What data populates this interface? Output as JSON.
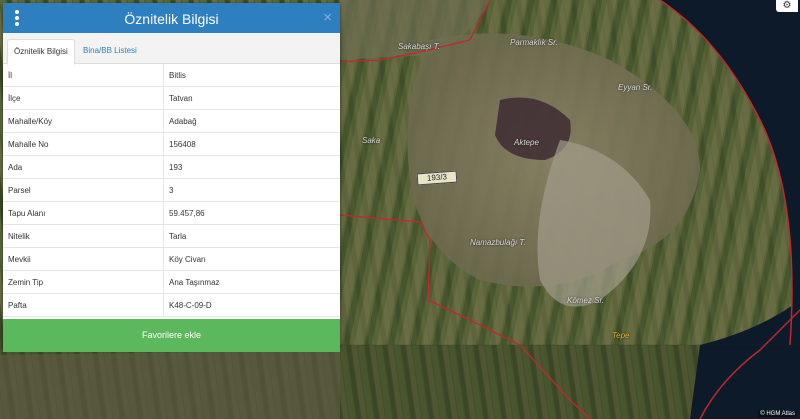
{
  "panel": {
    "title": "Öznitelik Bilgisi",
    "close_glyph": "×",
    "menu_icon": "vertical-dots-icon",
    "tabs": [
      {
        "label": "Öznitelik Bilgisi",
        "active": true
      },
      {
        "label": "Bina/BB Listesi",
        "active": false
      }
    ],
    "rows": [
      {
        "key": "İl",
        "value": "Bitlis"
      },
      {
        "key": "İlçe",
        "value": "Tatvan"
      },
      {
        "key": "Mahalle/Köy",
        "value": "Adabağ"
      },
      {
        "key": "Mahalle No",
        "value": "156408"
      },
      {
        "key": "Ada",
        "value": "193"
      },
      {
        "key": "Parsel",
        "value": "3"
      },
      {
        "key": "Tapu Alanı",
        "value": "59.457,86"
      },
      {
        "key": "Nitelik",
        "value": "Tarla"
      },
      {
        "key": "Mevkii",
        "value": "Köy Civarı"
      },
      {
        "key": "Zemin Tip",
        "value": "Ana Taşınmaz"
      },
      {
        "key": "Pafta",
        "value": "K48-C-09-D"
      }
    ],
    "favorite_button": "Favorilere ekle",
    "colors": {
      "header": "#2d7fc0",
      "button": "#5cb85c",
      "boundary": "#c0282d"
    }
  },
  "map": {
    "parcel_label": "193/3",
    "settings_icon": "gear-icon",
    "attribution": "© HGM Atlas",
    "place_labels": [
      "Sakabaşı T.",
      "Parmaklık Sr.",
      "Eyyan Sr.",
      "Saka",
      "Aktepe",
      "Namazbulağı T.",
      "Kömez Sr.",
      "Tepe"
    ]
  }
}
